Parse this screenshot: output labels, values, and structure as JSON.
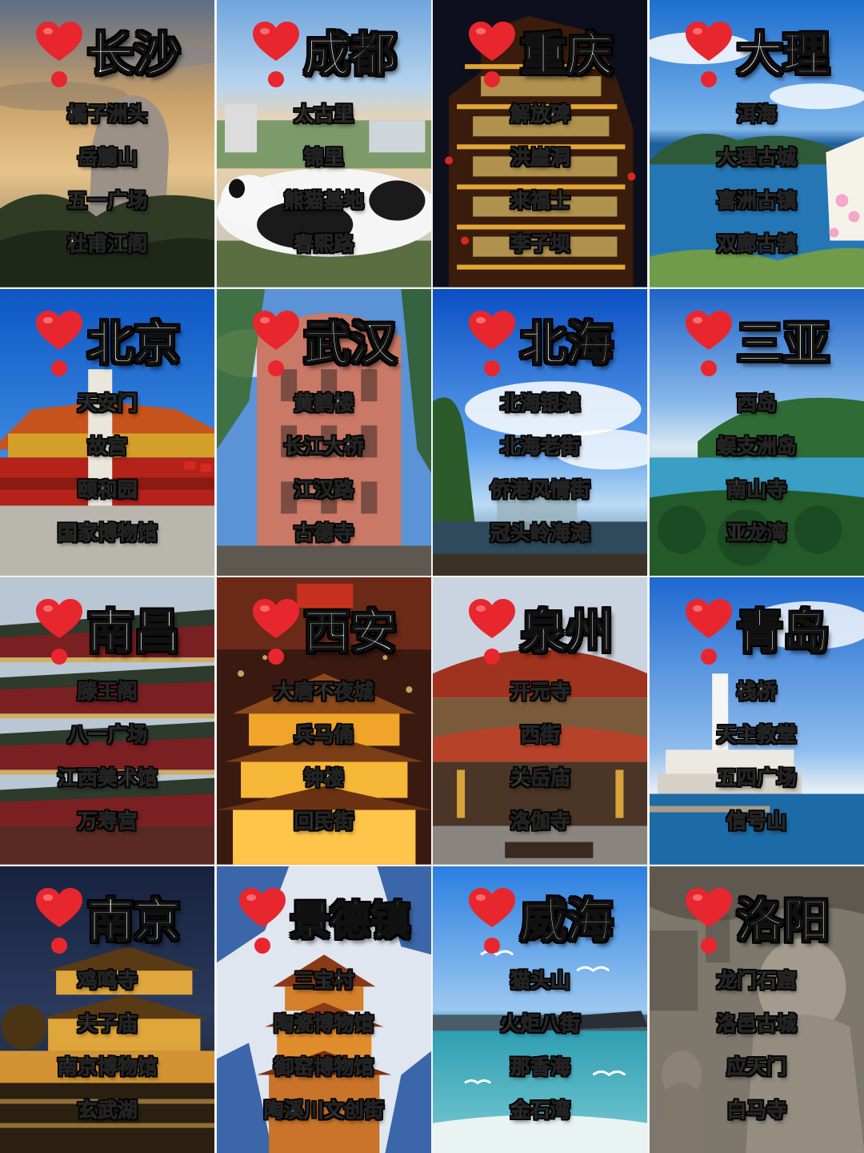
{
  "cities": [
    {
      "name": "长沙",
      "spots": [
        "橘子洲头",
        "岳麓山",
        "五一广场",
        "杜甫江阁"
      ]
    },
    {
      "name": "成都",
      "spots": [
        "太古里",
        "锦里",
        "熊猫基地",
        "春熙路"
      ]
    },
    {
      "name": "重庆",
      "spots": [
        "解放碑",
        "洪崖洞",
        "来福士",
        "李子坝"
      ]
    },
    {
      "name": "大理",
      "spots": [
        "洱海",
        "大理古城",
        "喜洲古镇",
        "双廊古镇"
      ]
    },
    {
      "name": "北京",
      "spots": [
        "天安门",
        "故宫",
        "颐和园",
        "国家博物馆"
      ]
    },
    {
      "name": "武汉",
      "spots": [
        "黄鹤楼",
        "长江大桥",
        "江汉路",
        "古德寺"
      ]
    },
    {
      "name": "北海",
      "spots": [
        "北海银滩",
        "北海老街",
        "侨港风情街",
        "冠头岭海滩"
      ]
    },
    {
      "name": "三亚",
      "spots": [
        "西岛",
        "蜈支洲岛",
        "南山寺",
        "亚龙湾"
      ]
    },
    {
      "name": "南昌",
      "spots": [
        "滕王阁",
        "八一广场",
        "江西美术馆",
        "万寿宫"
      ]
    },
    {
      "name": "西安",
      "spots": [
        "大唐不夜城",
        "兵马俑",
        "钟楼",
        "回民街"
      ]
    },
    {
      "name": "泉州",
      "spots": [
        "开元寺",
        "西街",
        "关岳庙",
        "洛伽寺"
      ]
    },
    {
      "name": "青岛",
      "spots": [
        "栈桥",
        "天主教堂",
        "五四广场",
        "信号山"
      ]
    },
    {
      "name": "南京",
      "spots": [
        "鸡鸣寺",
        "夫子庙",
        "南京博物馆",
        "玄武湖"
      ]
    },
    {
      "name": "景德镇",
      "spots": [
        "三宝村",
        "陶瓷博物馆",
        "御窑博物馆",
        "陶溪川文创街"
      ]
    },
    {
      "name": "威海",
      "spots": [
        "猫头山",
        "火炬八街",
        "那香海",
        "金石湾"
      ]
    },
    {
      "name": "洛阳",
      "spots": [
        "龙门石窟",
        "洛邑古城",
        "应天门",
        "白马寺"
      ]
    }
  ],
  "icons": {
    "title_marker": "heart-exclamation-icon"
  },
  "colors": {
    "heart_red": "#e8262e",
    "city_text": "#ffffff",
    "spot_text": "#fff9d6"
  }
}
